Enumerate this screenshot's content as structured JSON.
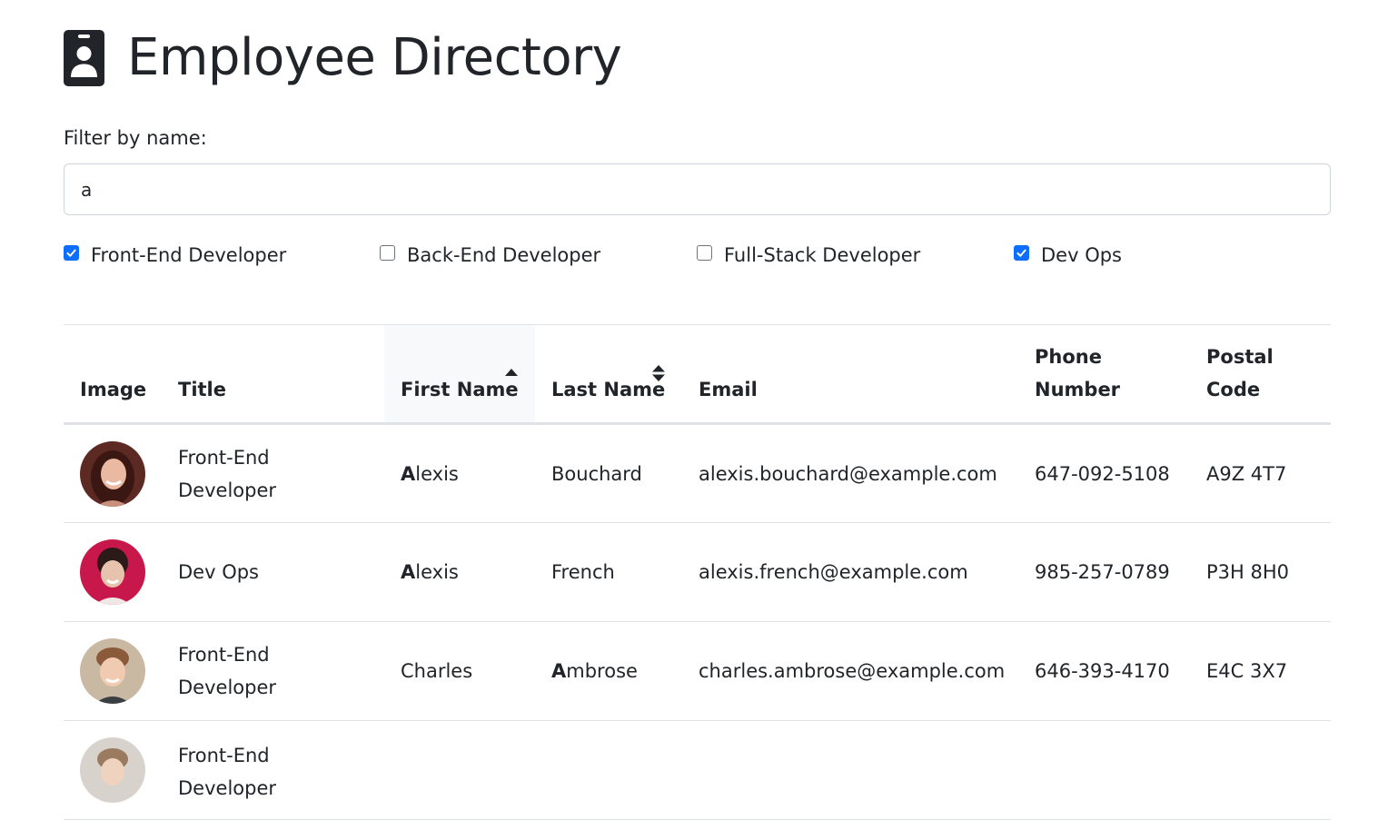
{
  "header": {
    "title": "Employee Directory",
    "icon": "id-badge-icon"
  },
  "filter": {
    "label": "Filter by name:",
    "value": "a"
  },
  "roles": [
    {
      "label": "Front-End Developer",
      "checked": true
    },
    {
      "label": "Back-End Developer",
      "checked": false
    },
    {
      "label": "Full-Stack Developer",
      "checked": false
    },
    {
      "label": "Dev Ops",
      "checked": true
    }
  ],
  "table": {
    "columns": {
      "image": "Image",
      "title": "Title",
      "first_name": "First Name",
      "last_name": "Last Name",
      "email": "Email",
      "phone": "Phone Number",
      "postal": "Postal Code"
    },
    "sort": {
      "column": "first_name",
      "direction": "ascending"
    },
    "rows": [
      {
        "title": "Front-End Developer",
        "first_hl": "A",
        "first_rest": "lexis",
        "last_hl": "",
        "last_rest": "Bouchard",
        "email": "alexis.bouchard@example.com",
        "phone": "647-092-5108",
        "postal": "A9Z 4T7"
      },
      {
        "title": "Dev Ops",
        "first_hl": "A",
        "first_rest": "lexis",
        "last_hl": "",
        "last_rest": "French",
        "email": "alexis.french@example.com",
        "phone": "985-257-0789",
        "postal": "P3H 8H0"
      },
      {
        "title": "Front-End Developer",
        "first_hl": "",
        "first_rest": "Charles",
        "last_hl": "A",
        "last_rest": "mbrose",
        "email": "charles.ambrose@example.com",
        "phone": "646-393-4170",
        "postal": "E4C 3X7"
      },
      {
        "title": "Front-End Developer",
        "first_hl": "",
        "first_rest": "",
        "last_hl": "",
        "last_rest": "",
        "email": "",
        "phone": "",
        "postal": ""
      }
    ]
  },
  "colors": {
    "text": "#212529",
    "border": "#dee2e6",
    "checkbox_checked": "#0d6efd",
    "sorted_header_bg": "#f8f9fa"
  }
}
